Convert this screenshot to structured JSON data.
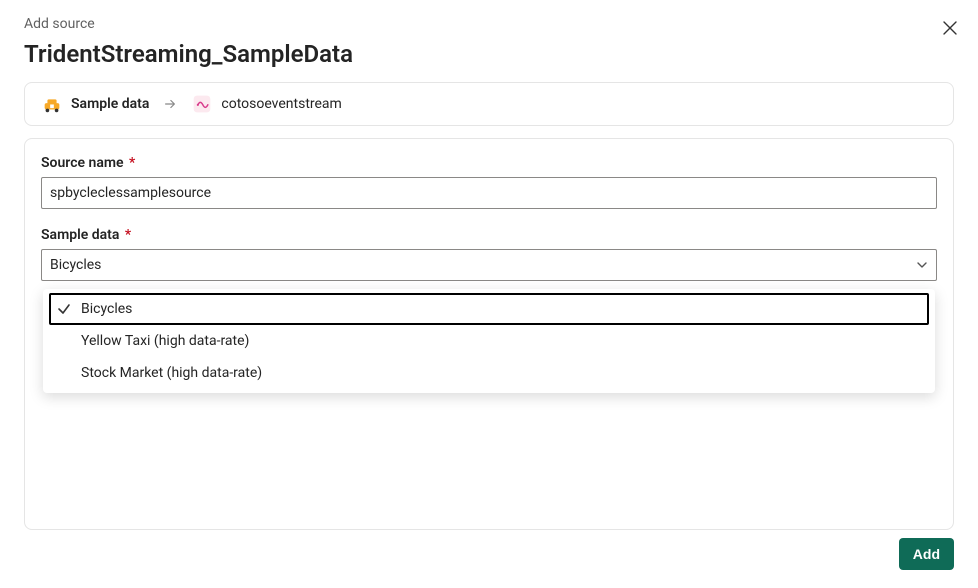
{
  "header": {
    "subtitle": "Add source",
    "title": "TridentStreaming_SampleData"
  },
  "breadcrumb": {
    "source_label": "Sample data",
    "dest_label": "cotosoeventstream"
  },
  "form": {
    "source_name": {
      "label": "Source name",
      "required": "*",
      "value": "spbycleclessamplesource"
    },
    "sample_data": {
      "label": "Sample data",
      "required": "*",
      "selected": "Bicycles",
      "options": [
        {
          "label": "Bicycles",
          "selected": true
        },
        {
          "label": "Yellow Taxi (high data-rate)",
          "selected": false
        },
        {
          "label": "Stock Market (high data-rate)",
          "selected": false
        }
      ]
    }
  },
  "footer": {
    "add_label": "Add"
  },
  "colors": {
    "primary_button": "#0f6b57",
    "required_asterisk": "#c50f1f"
  }
}
